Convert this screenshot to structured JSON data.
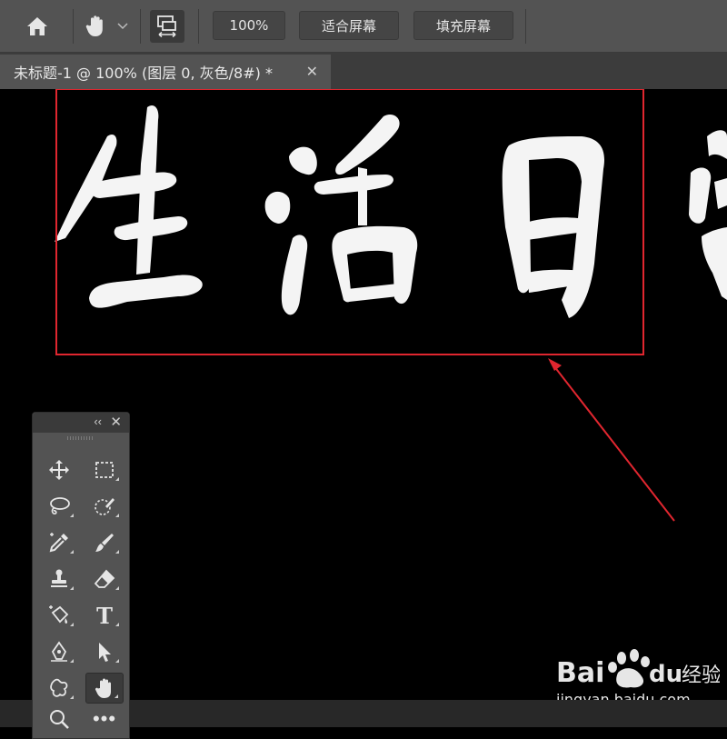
{
  "toolbar": {
    "zoom_label": "100%",
    "fit_screen_label": "适合屏幕",
    "fill_screen_label": "填充屏幕",
    "icons": [
      "home-icon",
      "hand-icon",
      "chevron-down-icon",
      "scroll-all-windows-icon"
    ]
  },
  "document_tab": {
    "title": "未标题-1 @ 100% (图层 0, 灰色/8#) *",
    "close": "✕"
  },
  "canvas": {
    "background": "#000000",
    "artwork_text": "生活日常",
    "highlight_box_color": "#e0262f",
    "arrow_color": "#e0262f"
  },
  "toolbox": {
    "collapse": "‹‹",
    "close": "✕",
    "tools": [
      "move-tool-icon",
      "marquee-tool-icon",
      "lasso-tool-icon",
      "quick-selection-tool-icon",
      "eyedropper-tool-icon",
      "brush-tool-icon",
      "clone-stamp-tool-icon",
      "eraser-tool-icon",
      "paint-bucket-tool-icon",
      "type-tool-icon",
      "pen-tool-icon",
      "path-selection-tool-icon",
      "custom-shape-tool-icon",
      "hand-tool-icon",
      "zoom-tool-icon",
      "more-tools-icon"
    ],
    "type_tool_glyph": "T",
    "more_glyph": "•••",
    "active_tool": "hand-tool-icon"
  },
  "watermark": {
    "brand": "Bai du 经验",
    "url": "jingyan.baidu.com"
  }
}
